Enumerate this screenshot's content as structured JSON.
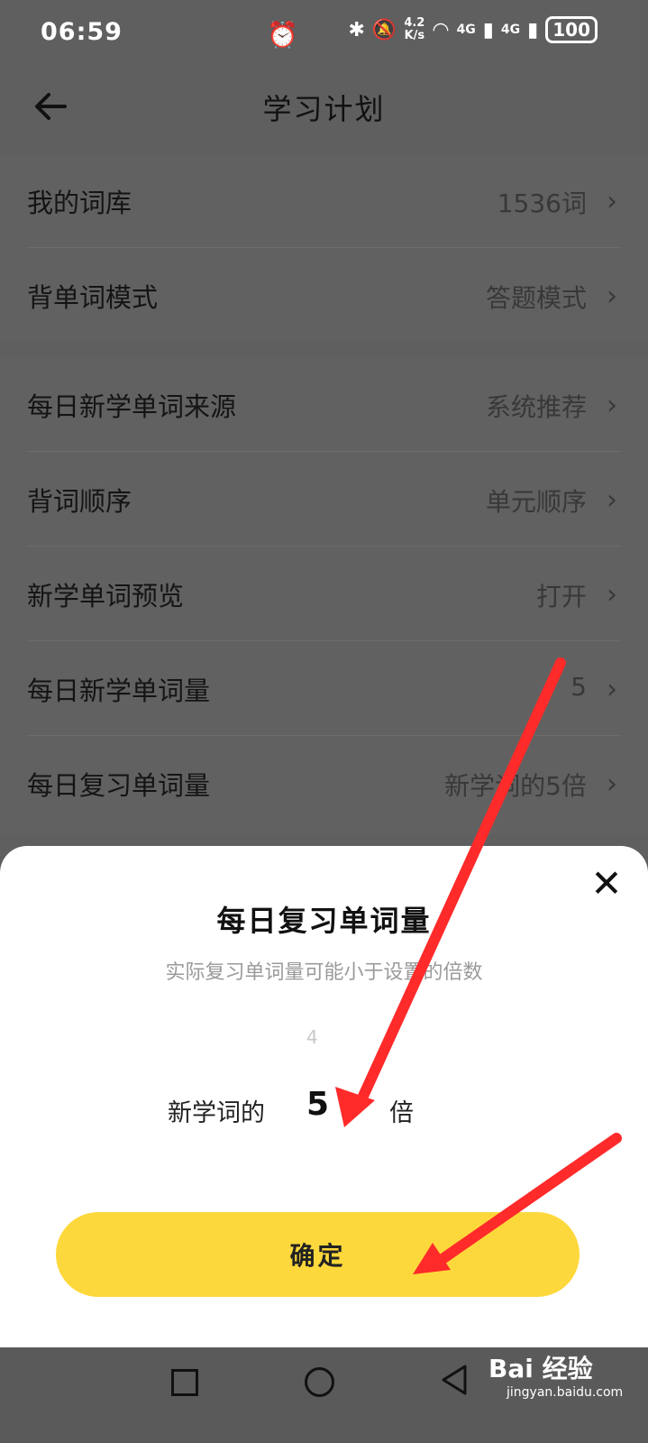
{
  "status_bar": {
    "time": "06:59",
    "speed": "4.2\nK/s",
    "signal1": "4G",
    "signal2": "4G",
    "battery": "100"
  },
  "header": {
    "title": "学习计划"
  },
  "section1": [
    {
      "label": "我的词库",
      "value": "1536词"
    },
    {
      "label": "背单词模式",
      "value": "答题模式"
    }
  ],
  "section2": [
    {
      "label": "每日新学单词来源",
      "value": "系统推荐"
    },
    {
      "label": "背词顺序",
      "value": "单元顺序"
    },
    {
      "label": "新学单词预览",
      "value": "打开"
    },
    {
      "label": "每日新学单词量",
      "value": "5"
    },
    {
      "label": "每日复习单词量",
      "value": "新学词的5倍"
    }
  ],
  "sheet": {
    "title": "每日复习单词量",
    "subtitle": "实际复习单词量可能小于设置的倍数",
    "picker_prev": "4",
    "picker_prefix": "新学词的",
    "picker_value": "5",
    "picker_suffix": "倍",
    "confirm": "确定"
  },
  "watermark": {
    "brand": "Bai 经验",
    "url": "jingyan.baidu.com"
  }
}
